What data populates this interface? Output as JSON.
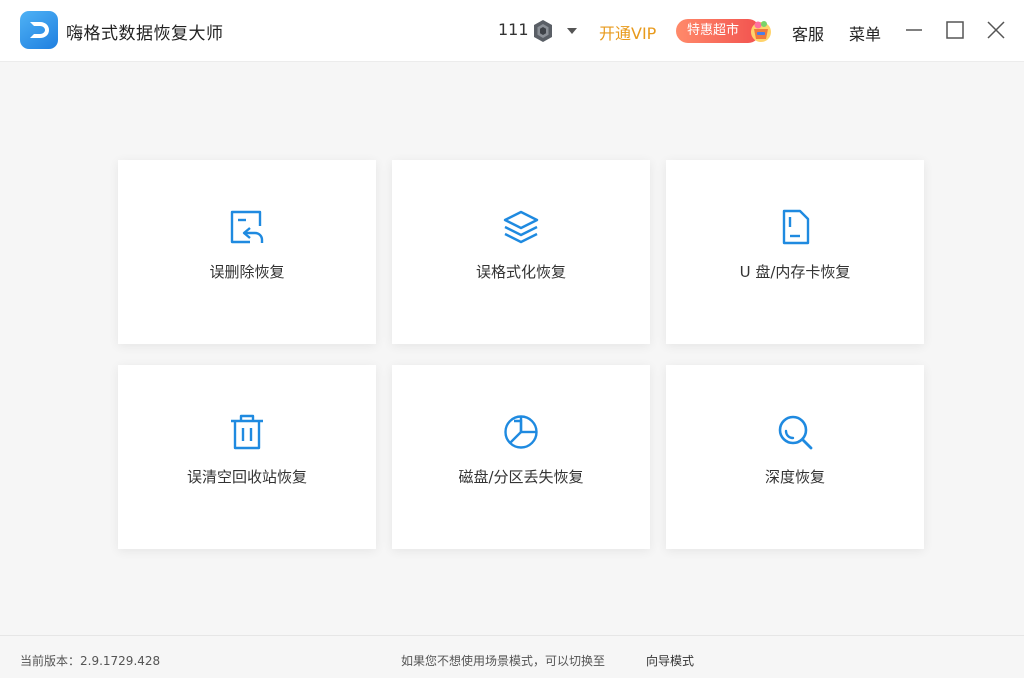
{
  "app": {
    "title": "嗨格式数据恢复大师"
  },
  "header": {
    "user_id": "111",
    "vip_label": "开通VIP",
    "promo_label": "特惠超市",
    "service_label": "客服",
    "menu_label": "菜单"
  },
  "colors": {
    "accent": "#1f8ae0",
    "vip": "#e89a1c",
    "promo": "#f2524f"
  },
  "cards": [
    {
      "label": "误删除恢复",
      "icon": "file-restore-icon"
    },
    {
      "label": "误格式化恢复",
      "icon": "layers-icon"
    },
    {
      "label": "U 盘/内存卡恢复",
      "icon": "sd-card-icon"
    },
    {
      "label": "误清空回收站恢复",
      "icon": "trash-icon"
    },
    {
      "label": "磁盘/分区丢失恢复",
      "icon": "pie-chart-icon"
    },
    {
      "label": "深度恢复",
      "icon": "search-icon"
    }
  ],
  "footer": {
    "version": "当前版本：2.9.1729.428",
    "hint": "如果您不想使用场景模式，可以切换至",
    "mode_link": "向导模式"
  }
}
